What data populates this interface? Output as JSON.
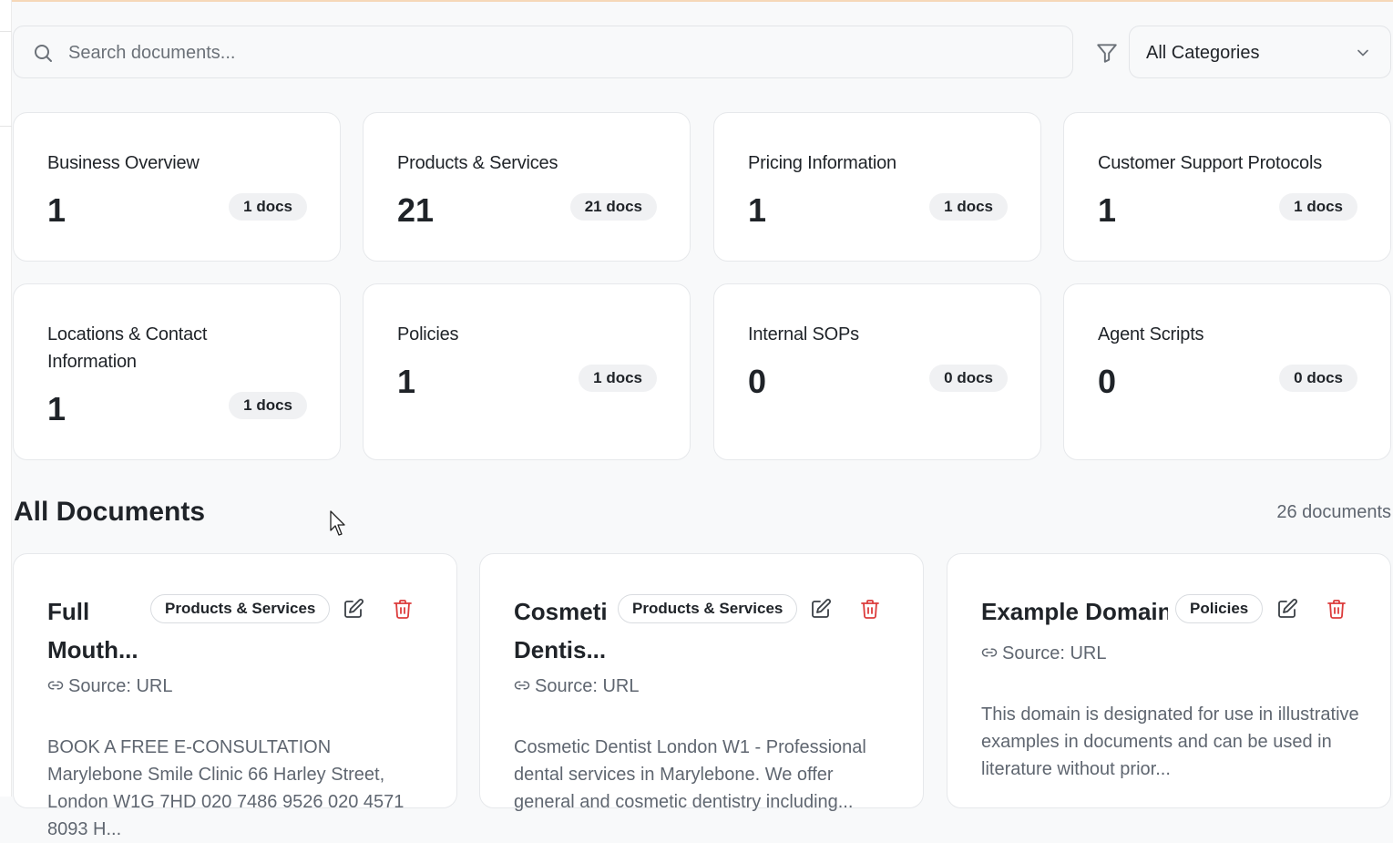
{
  "search": {
    "placeholder": "Search documents..."
  },
  "filter": {
    "selected": "All Categories"
  },
  "categories": [
    {
      "title": "Business Overview",
      "count": "1",
      "badge": "1 docs"
    },
    {
      "title": "Products & Services",
      "count": "21",
      "badge": "21 docs"
    },
    {
      "title": "Pricing Information",
      "count": "1",
      "badge": "1 docs"
    },
    {
      "title": "Customer Support Protocols",
      "count": "1",
      "badge": "1 docs"
    },
    {
      "title": "Locations & Contact Information",
      "count": "1",
      "badge": "1 docs"
    },
    {
      "title": "Policies",
      "count": "1",
      "badge": "1 docs"
    },
    {
      "title": "Internal SOPs",
      "count": "0",
      "badge": "0 docs"
    },
    {
      "title": "Agent Scripts",
      "count": "0",
      "badge": "0 docs"
    }
  ],
  "documents_section": {
    "title": "All Documents",
    "count_label": "26 documents"
  },
  "documents": [
    {
      "title_line1": "Full",
      "title_line2": "Mouth...",
      "category": "Products & Services",
      "source": "Source: URL",
      "excerpt": "BOOK A FREE E-CONSULTATION Marylebone Smile Clinic 66 Harley Street, London W1G 7HD 020 7486 9526 020 4571 8093 H..."
    },
    {
      "title_line1": "Cosmetic",
      "title_line2": "Dentis...",
      "category": "Products & Services",
      "source": "Source: URL",
      "excerpt": "Cosmetic Dentist London W1 - Professional dental services in Marylebone. We offer general and cosmetic dentistry including..."
    },
    {
      "title_line1": "Example Domain",
      "category": "Policies",
      "source": "Source: URL",
      "excerpt": "This domain is designated for use in illustrative examples in documents and can be used in literature without prior..."
    }
  ],
  "colors": {
    "delete": "#dc3c3c",
    "accent_line": "#f6d8b8"
  }
}
